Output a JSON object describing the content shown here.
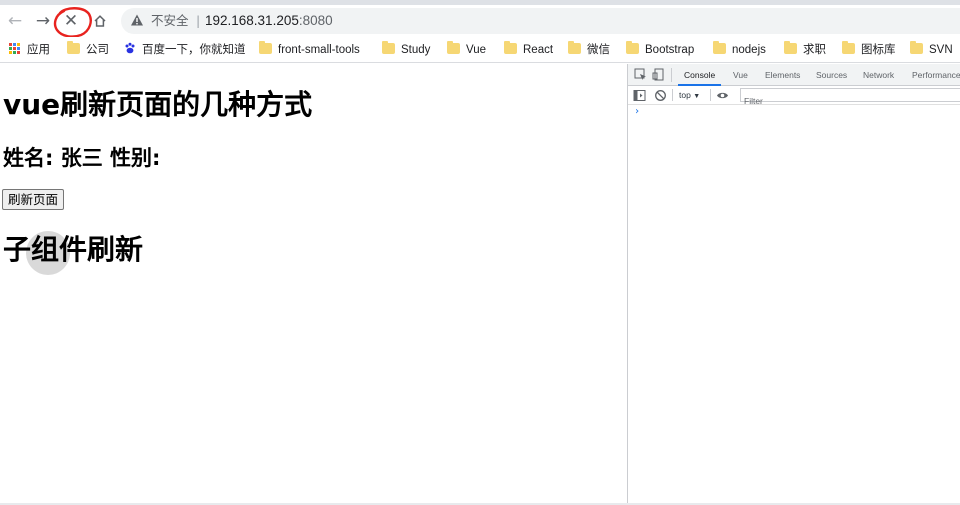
{
  "browser": {
    "insecure_label": "不安全",
    "separator": "|",
    "url_host": "192.168.31.205",
    "url_port": ":8080"
  },
  "bookmarks": [
    {
      "label": "应用",
      "icon": "apps-grid-icon"
    },
    {
      "label": "公司",
      "icon": "folder-icon"
    },
    {
      "label": "百度一下，你就知道",
      "icon": "baidu-paw-icon"
    },
    {
      "label": "front-small-tools",
      "icon": "folder-icon"
    },
    {
      "label": "Study",
      "icon": "folder-icon"
    },
    {
      "label": "Vue",
      "icon": "folder-icon"
    },
    {
      "label": "React",
      "icon": "folder-icon"
    },
    {
      "label": "微信",
      "icon": "folder-icon"
    },
    {
      "label": "Bootstrap",
      "icon": "folder-icon"
    },
    {
      "label": "nodejs",
      "icon": "folder-icon"
    },
    {
      "label": "求职",
      "icon": "folder-icon"
    },
    {
      "label": "图标库",
      "icon": "folder-icon"
    },
    {
      "label": "SVN",
      "icon": "folder-icon"
    }
  ],
  "page": {
    "title": "vue刷新页面的几种方式",
    "info": "姓名: 张三 性别:",
    "refresh_button": "刷新页面",
    "child_title": "子组件刷新"
  },
  "devtools": {
    "tabs": [
      "Console",
      "Vue",
      "Elements",
      "Sources",
      "Network",
      "Performance"
    ],
    "active_tab": "Console",
    "context": "top",
    "filter_placeholder": "Filter",
    "prompt": "›"
  },
  "colors": {
    "accent": "#1a73e8",
    "folder": "#f6d774",
    "annotation": "#e8231f"
  }
}
